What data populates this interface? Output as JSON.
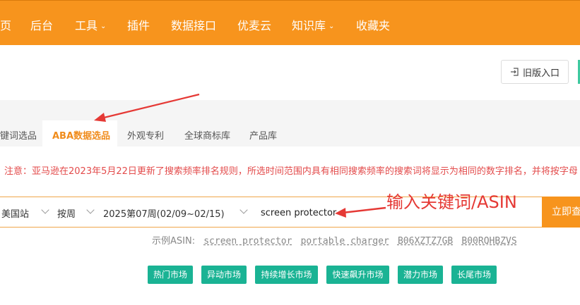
{
  "nav": {
    "items": [
      {
        "label": "页",
        "dropdown": false
      },
      {
        "label": "后台",
        "dropdown": false
      },
      {
        "label": "工具",
        "dropdown": true
      },
      {
        "label": "插件",
        "dropdown": false
      },
      {
        "label": "数据接口",
        "dropdown": false
      },
      {
        "label": "优麦云",
        "dropdown": false
      },
      {
        "label": "知识库",
        "dropdown": true
      },
      {
        "label": "收藏夹",
        "dropdown": false
      }
    ],
    "caret": "⌄"
  },
  "toolbar": {
    "old_entry_label": "旧版入口"
  },
  "tabs": [
    {
      "label": "键词选品",
      "active": false
    },
    {
      "label": "ABA数据选品",
      "active": true
    },
    {
      "label": "外观专利",
      "active": false
    },
    {
      "label": "全球商标库",
      "active": false
    },
    {
      "label": "产品库",
      "active": false
    }
  ],
  "notice": "注意：亚马逊在2023年5月22日更新了搜索频率排名规则，所选时间范围内具有相同搜索频率的搜索词将显示为相同的数字排名，并将按字母",
  "search": {
    "site": "美国站",
    "period_type": "按周",
    "week": "2025第07周(02/09~02/15)",
    "value": "screen protector",
    "button_label": "立即查"
  },
  "annotation": "输入关键词/ASIN",
  "examples": {
    "label": "示例ASIN:",
    "items": [
      "screen protector",
      "portable charger",
      "B06XZTZ7GB",
      "B00RQHBZVS"
    ]
  },
  "chips": [
    "热门市场",
    "异动市场",
    "持续增长市场",
    "快速飙升市场",
    "潜力市场",
    "长尾市场"
  ],
  "colors": {
    "brand_orange": "#f7941d",
    "chip_green": "#1ab394",
    "notice_red": "#e34b4b",
    "arrow_red": "#e53935"
  }
}
